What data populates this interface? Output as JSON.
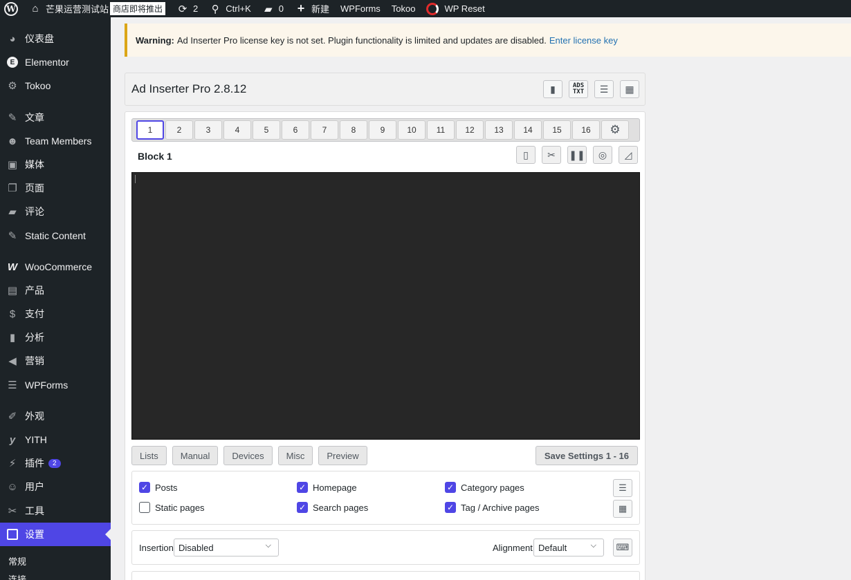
{
  "adminbar": {
    "site_name": "芒果运营测试站",
    "store_badge": "商店即将推出",
    "updates_count": "2",
    "search_shortcut": "Ctrl+K",
    "comments_count": "0",
    "new_label": "新建",
    "wpforms": "WPForms",
    "tokoo": "Tokoo",
    "wp_reset": "WP Reset"
  },
  "sidebar": {
    "items": [
      {
        "label": "仪表盘",
        "icon": "dashboard-icon"
      },
      {
        "label": "Elementor",
        "icon": "elementor-icon"
      },
      {
        "label": "Tokoo",
        "icon": "gear-icon"
      },
      {
        "label": "文章",
        "icon": "pin-icon"
      },
      {
        "label": "Team Members",
        "icon": "people-icon"
      },
      {
        "label": "媒体",
        "icon": "media-icon"
      },
      {
        "label": "页面",
        "icon": "page-icon"
      },
      {
        "label": "评论",
        "icon": "comment-icon"
      },
      {
        "label": "Static Content",
        "icon": "pin-icon"
      },
      {
        "label": "WooCommerce",
        "icon": "woo-icon"
      },
      {
        "label": "产品",
        "icon": "archive-icon"
      },
      {
        "label": "支付",
        "icon": "money-icon"
      },
      {
        "label": "分析",
        "icon": "bar-chart-icon"
      },
      {
        "label": "营销",
        "icon": "megaphone-icon"
      },
      {
        "label": "WPForms",
        "icon": "form-icon"
      },
      {
        "label": "外观",
        "icon": "brush-icon"
      },
      {
        "label": "YITH",
        "icon": "yith-icon"
      },
      {
        "label": "插件",
        "icon": "plugin-icon",
        "badge": "2"
      },
      {
        "label": "用户",
        "icon": "user-icon"
      },
      {
        "label": "工具",
        "icon": "wrench-icon"
      },
      {
        "label": "设置",
        "icon": "settings-icon",
        "current": true
      }
    ],
    "submenu": [
      "常规",
      "连接"
    ]
  },
  "notice": {
    "warning_label": "Warning:",
    "text": "Ad Inserter Pro license key is not set. Plugin functionality is limited and updates are disabled.",
    "link": "Enter license key"
  },
  "header": {
    "title": "Ad Inserter Pro 2.8.12",
    "ads_txt_top": "ADS",
    "ads_txt_bottom": "TXT"
  },
  "tabs": [
    "1",
    "2",
    "3",
    "4",
    "5",
    "6",
    "7",
    "8",
    "9",
    "10",
    "11",
    "12",
    "13",
    "14",
    "15",
    "16"
  ],
  "active_tab": "1",
  "block": {
    "title": "Block 1"
  },
  "toolbar": {
    "lists": "Lists",
    "manual": "Manual",
    "devices": "Devices",
    "misc": "Misc",
    "preview": "Preview",
    "save": "Save Settings 1 - 16"
  },
  "checkboxes": [
    {
      "label": "Posts",
      "checked": true
    },
    {
      "label": "Homepage",
      "checked": true
    },
    {
      "label": "Category pages",
      "checked": true
    },
    {
      "label": "Static pages",
      "checked": false
    },
    {
      "label": "Search pages",
      "checked": true
    },
    {
      "label": "Tag / Archive pages",
      "checked": true
    }
  ],
  "insertion": {
    "label": "Insertion",
    "value": "Disabled"
  },
  "alignment": {
    "label": "Alignment",
    "value": "Default"
  },
  "colors": {
    "accent": "#4f46e5",
    "adminbar": "#1d2327",
    "editor_bg": "#272727",
    "notice_border": "#dba617"
  }
}
